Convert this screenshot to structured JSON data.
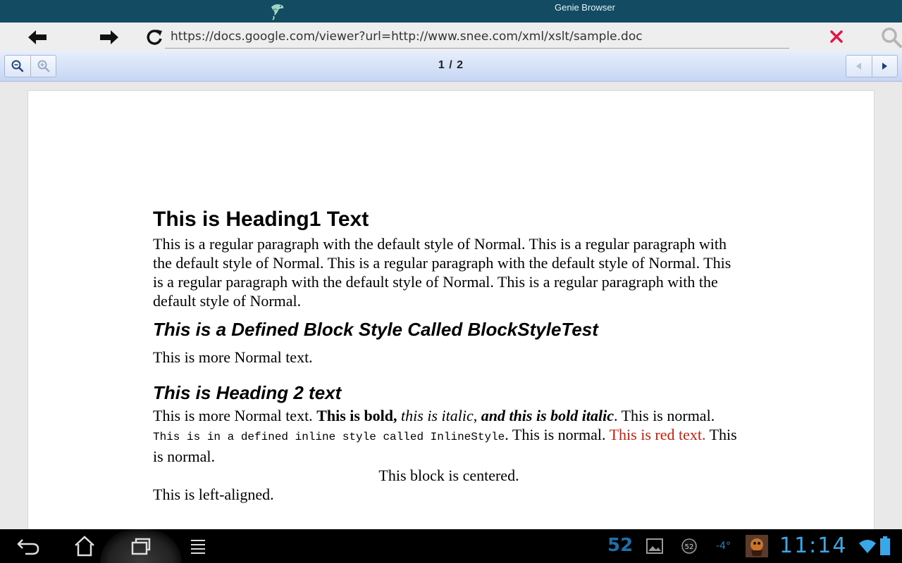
{
  "app": {
    "title": "Genie Browser",
    "logo_icon": "genie-bird-logo-icon"
  },
  "address_bar": {
    "back_icon": "arrow-left-icon",
    "forward_icon": "arrow-right-icon",
    "reload_icon": "reload-icon",
    "url": "https://docs.google.com/viewer?url=http://www.snee.com/xml/xslt/sample.doc",
    "close_icon": "close-x-icon",
    "close_color": "#e0174a",
    "search_icon": "search-icon"
  },
  "viewer_toolbar": {
    "zoom_in_icon": "zoom-in-icon",
    "zoom_out_icon": "zoom-out-icon",
    "page_indicator": "1 / 2",
    "prev_icon": "prev-page-icon",
    "next_icon": "next-page-icon"
  },
  "document": {
    "heading1": "This is Heading1 Text",
    "paragraph1": "This is a regular paragraph with the default style of Normal. This is a regular paragraph with the default style of Normal. This is a regular paragraph with the default style of Normal. This is a regular paragraph with the default style of Normal. This is a regular paragraph with the default style of Normal.",
    "block_style": "This is a Defined Block Style Called BlockStyleTest",
    "paragraph2": "This is more Normal text.",
    "heading2": "This is Heading 2 text",
    "mixed": {
      "normal_start": "This is more Normal text. ",
      "bold": "This is bold,",
      "italic": " this is italic",
      "comma": ", ",
      "bold_italic": "and this is bold italic",
      "normal_mid": ". This is normal. ",
      "inline_style": "This is in a defined inline style called InlineStyle",
      "normal_mid2": ". This is normal. ",
      "red": "This is red text.",
      "normal_end": " This is normal."
    },
    "red_color": "#c8200c",
    "centered": "This block is centered.",
    "left_aligned": "This is left-aligned."
  },
  "system_bar": {
    "back_icon": "system-back-icon",
    "home_icon": "system-home-icon",
    "recent_icon": "system-recent-apps-icon",
    "menu_icon": "system-menu-icon",
    "notification_count": "52",
    "gallery_icon": "gallery-notification-icon",
    "badge_count": "52",
    "weather_text": "-4°",
    "game_icon": "game-notification-icon",
    "clock": "11:14",
    "wifi_icon": "wifi-icon",
    "battery_icon": "battery-icon"
  }
}
